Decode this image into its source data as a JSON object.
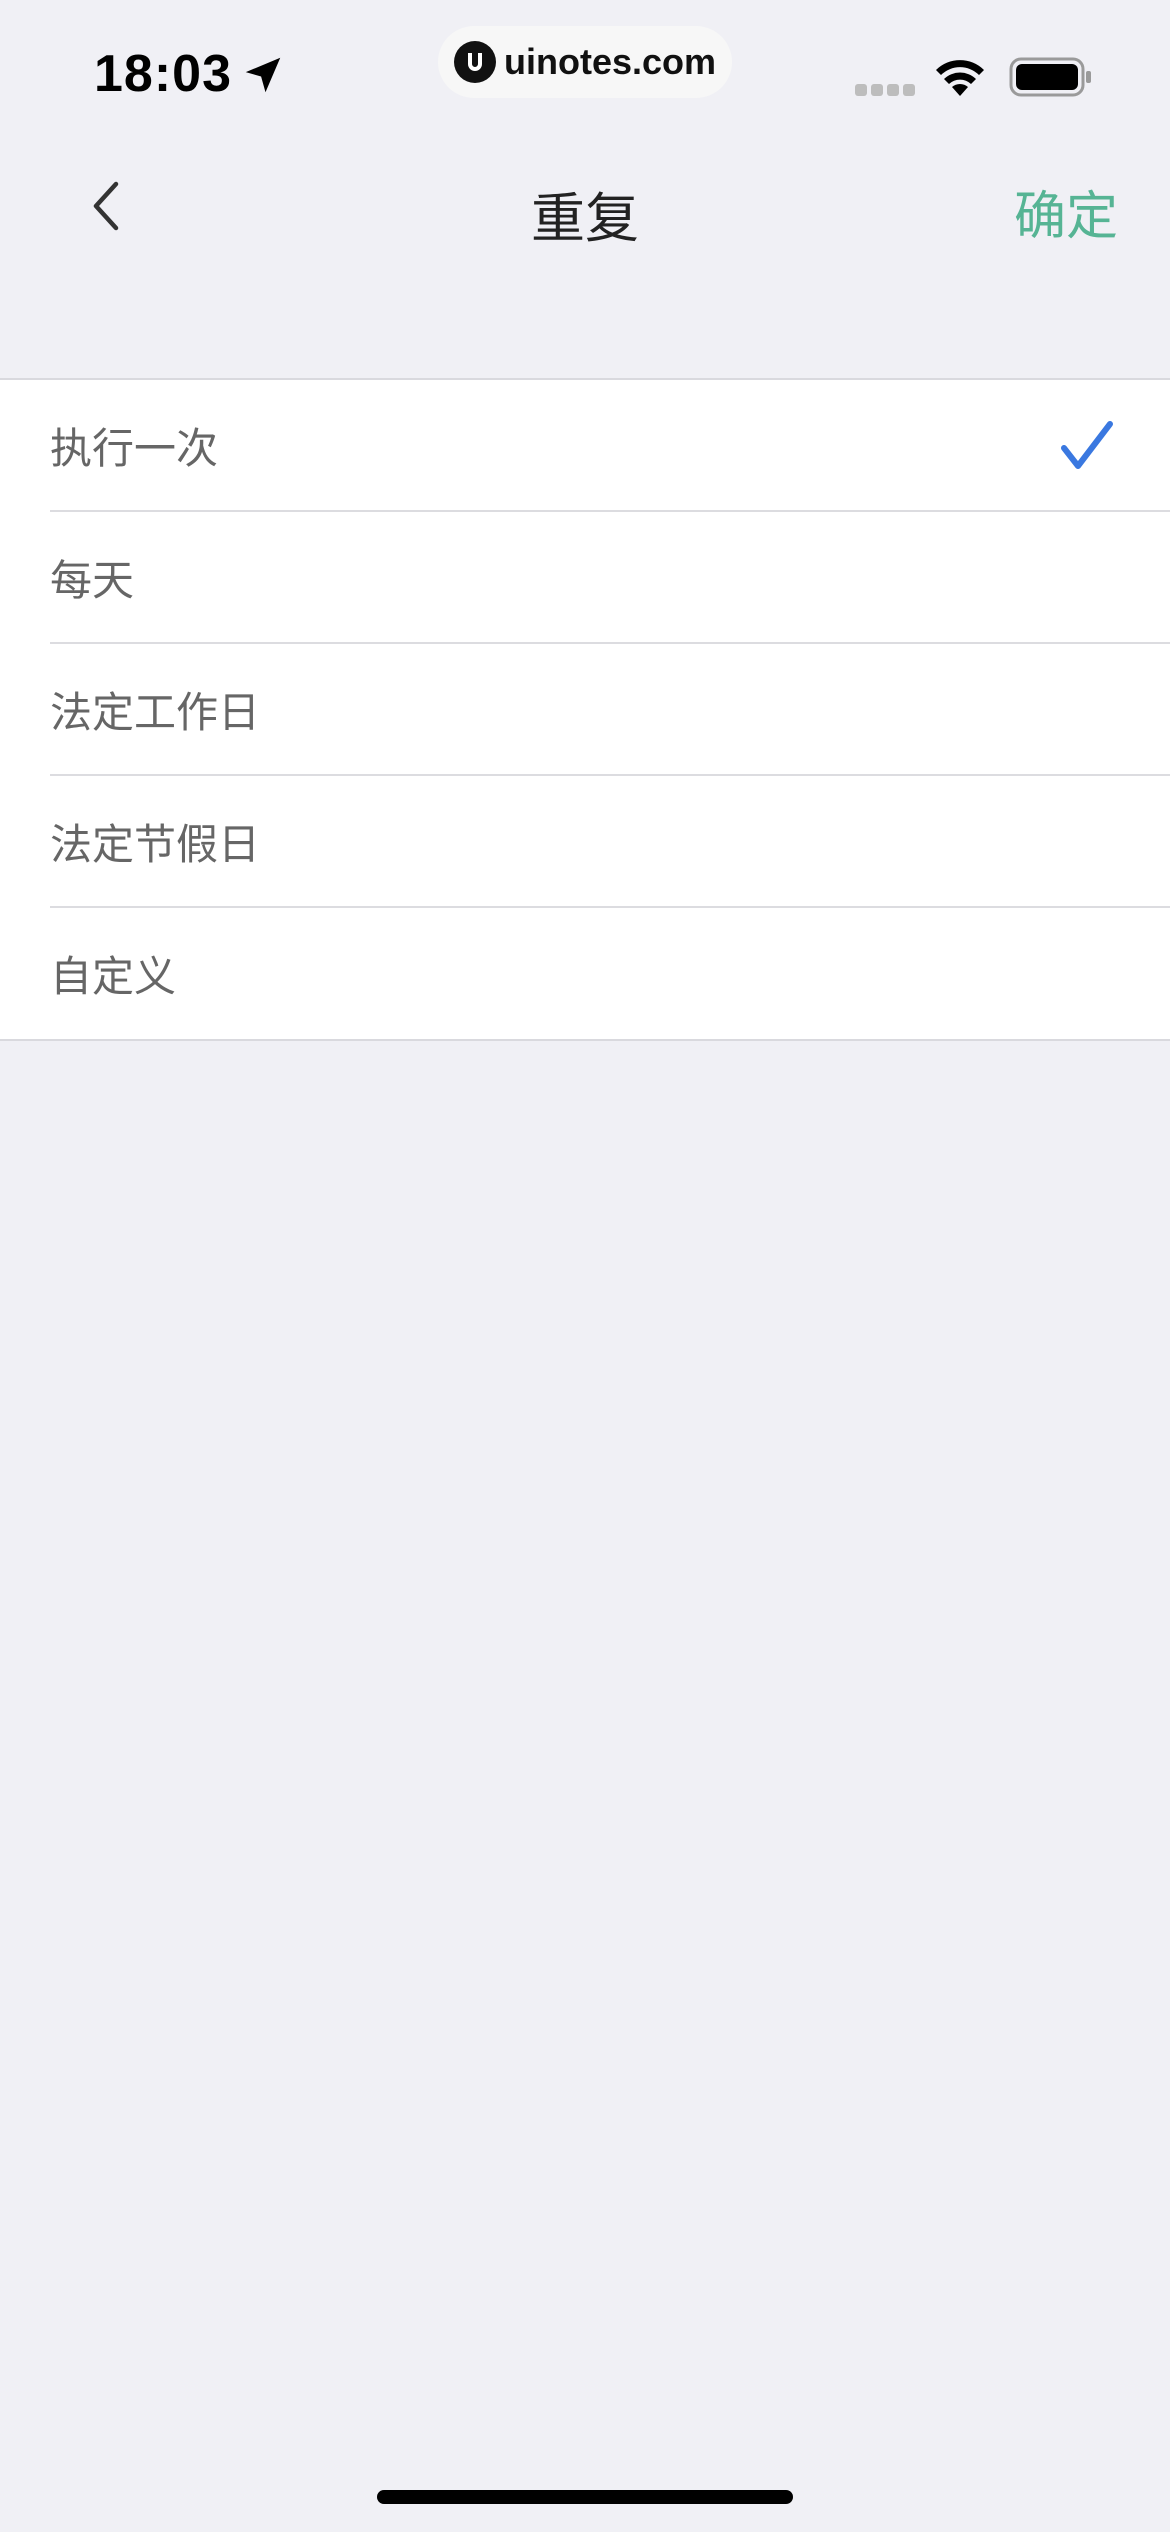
{
  "status_bar": {
    "time": "18:03",
    "url": "uinotes.com"
  },
  "nav": {
    "title": "重复",
    "confirm_label": "确定"
  },
  "options": [
    {
      "label": "执行一次",
      "selected": true
    },
    {
      "label": "每天",
      "selected": false
    },
    {
      "label": "法定工作日",
      "selected": false
    },
    {
      "label": "法定节假日",
      "selected": false
    },
    {
      "label": "自定义",
      "selected": false
    }
  ],
  "colors": {
    "accent": "#56b494",
    "check": "#3a78e0",
    "background": "#f0f0f5"
  }
}
